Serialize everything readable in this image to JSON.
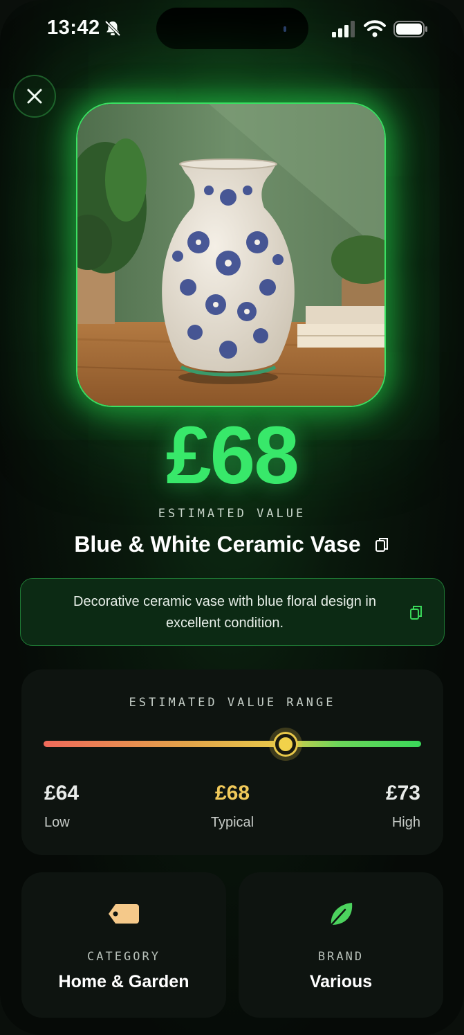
{
  "status_bar": {
    "time": "13:42"
  },
  "item": {
    "price": "£68",
    "price_label": "ESTIMATED VALUE",
    "title": "Blue & White Ceramic Vase",
    "description": "Decorative ceramic vase with blue floral design in excellent condition."
  },
  "range": {
    "label": "ESTIMATED VALUE RANGE",
    "low_value": "£64",
    "low_label": "Low",
    "typical_value": "£68",
    "typical_label": "Typical",
    "high_value": "£73",
    "high_label": "High"
  },
  "category": {
    "label": "CATEGORY",
    "value": "Home & Garden",
    "icon": "tag-icon"
  },
  "brand": {
    "label": "BRAND",
    "value": "Various",
    "icon": "leaf-icon"
  },
  "colors": {
    "accent_green": "#38e86a",
    "typical_gold": "#f0c95a",
    "tag_color": "#f5c98a",
    "leaf_color": "#4cd35e"
  }
}
